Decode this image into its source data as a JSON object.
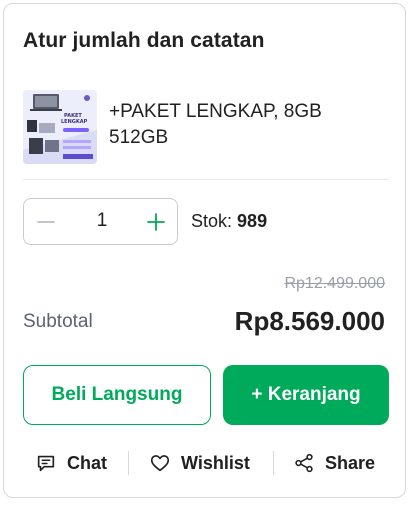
{
  "panel": {
    "title": "Atur jumlah dan catatan"
  },
  "product": {
    "name": "+PAKET LENGKAP, 8GB 512GB",
    "thumbnail_text": "PAKET LENGKAP"
  },
  "quantity": {
    "value": "1",
    "stock_label": "Stok:",
    "stock_value": "989"
  },
  "pricing": {
    "original_price": "Rp12.499.000",
    "subtotal_label": "Subtotal",
    "subtotal_value": "Rp8.569.000"
  },
  "buttons": {
    "buy_now": "Beli Langsung",
    "add_to_cart": "+ Keranjang"
  },
  "actions": {
    "chat": "Chat",
    "wishlist": "Wishlist",
    "share": "Share"
  },
  "colors": {
    "accent": "#00aa5b",
    "text": "#212121",
    "muted": "#9aa0a8"
  }
}
